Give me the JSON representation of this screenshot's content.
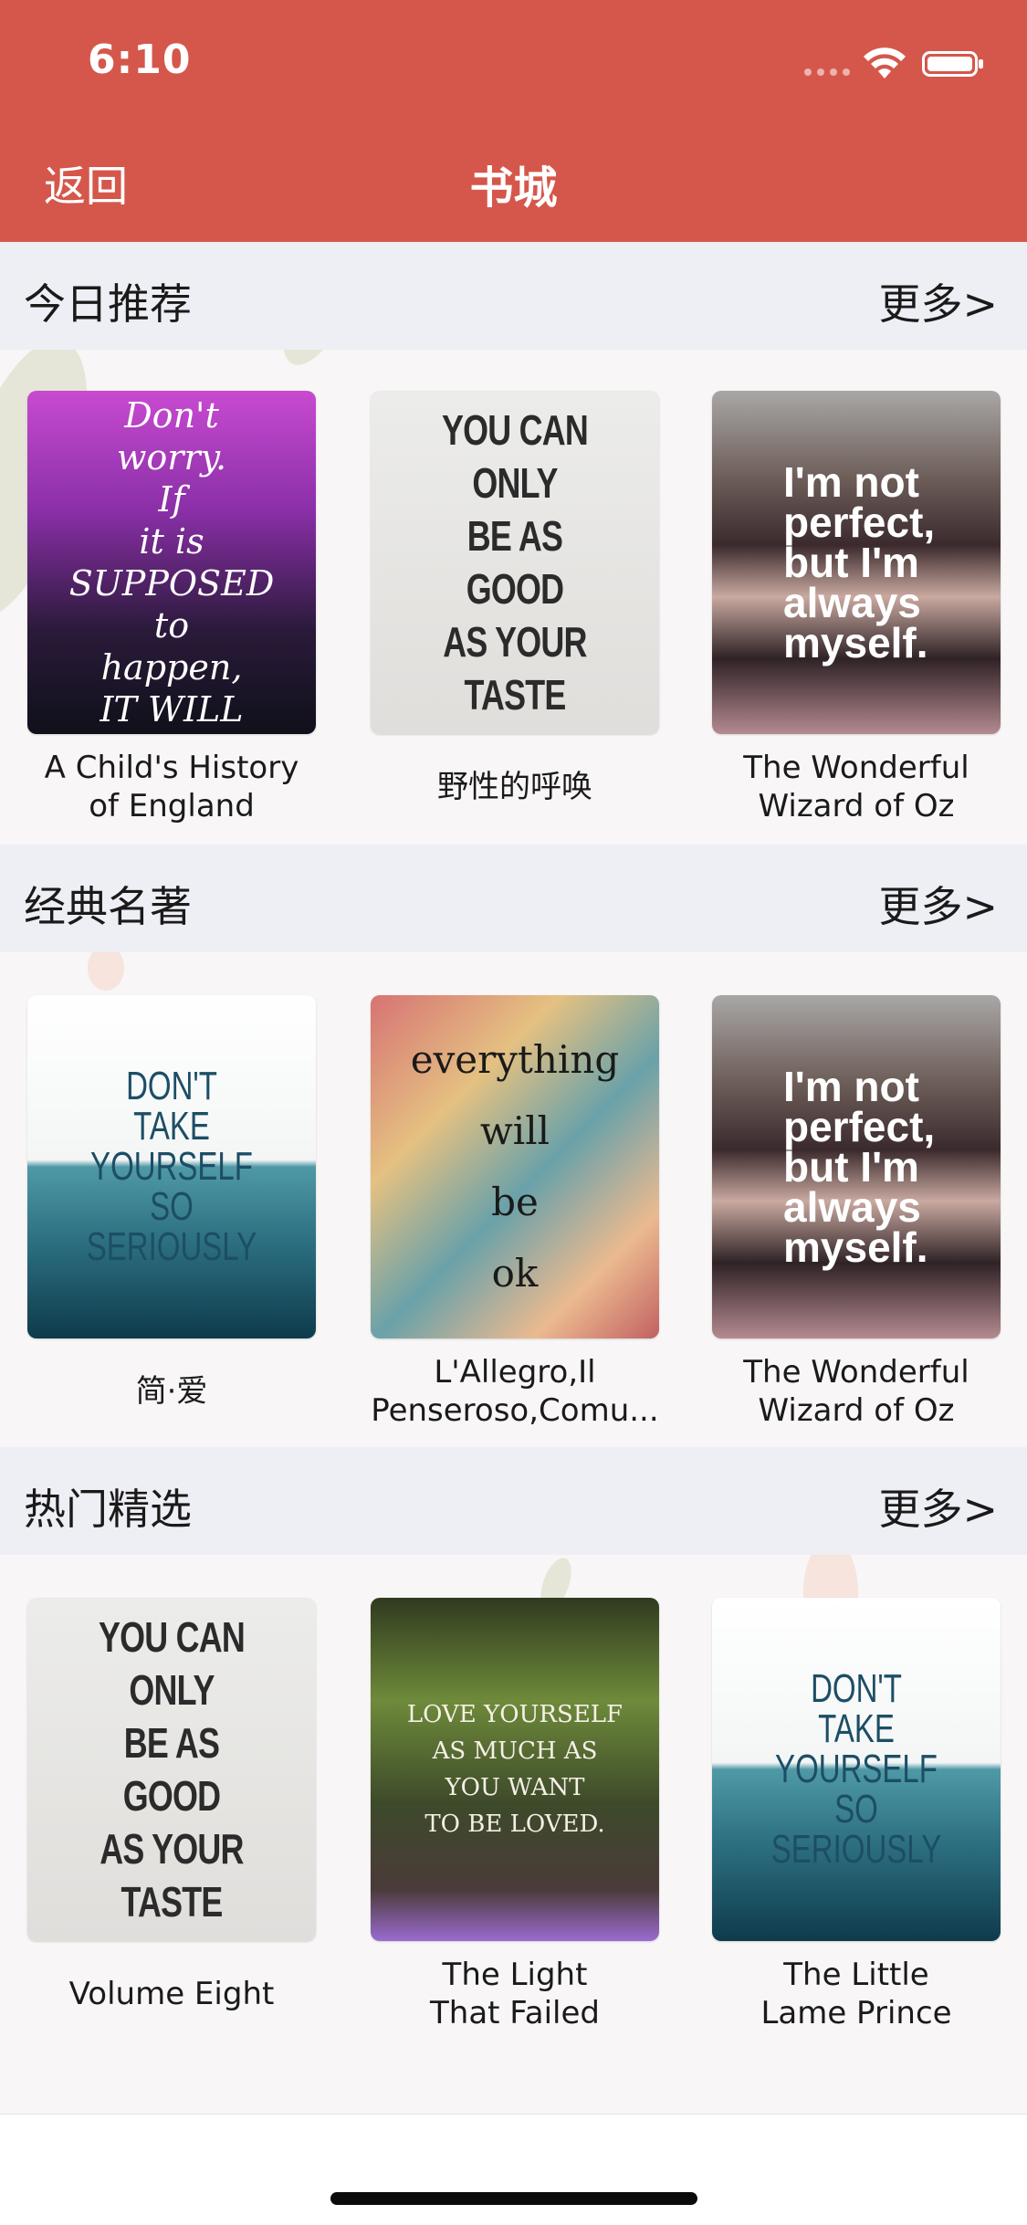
{
  "status_bar": {
    "time": "6:10"
  },
  "nav": {
    "back_label": "返回",
    "title": "书城"
  },
  "colors": {
    "header_red": "#d5574b",
    "section_bg": "#eeeff5"
  },
  "sections": [
    {
      "title": "今日推荐",
      "more_label": "更多>",
      "books": [
        {
          "title": "A Child's History\nof England",
          "cover_text": "Don't\nworry.\nIf\nit is\nSUPPOSED\nto\nhappen,\nIT WILL"
        },
        {
          "title": "野性的呼唤",
          "cover_text": "YOU CAN ONLY\nBE AS GOOD\nAS YOUR TASTE"
        },
        {
          "title": "The Wonderful\nWizard of Oz",
          "cover_text": "I'm not\nperfect,\nbut I'm\nalways\nmyself."
        }
      ]
    },
    {
      "title": "经典名著",
      "more_label": "更多>",
      "books": [
        {
          "title": "简·爱",
          "cover_text": "DON'T\nTAKE YOURSELF\nSO\nSERIOUSLY"
        },
        {
          "title": "L'Allegro,Il\nPenseroso,Comu...",
          "cover_text": "everything\nwill\nbe\nok"
        },
        {
          "title": "The Wonderful\nWizard of Oz",
          "cover_text": "I'm not\nperfect,\nbut I'm\nalways\nmyself."
        }
      ]
    },
    {
      "title": "热门精选",
      "more_label": "更多>",
      "books": [
        {
          "title": "Volume Eight",
          "cover_text": "YOU CAN ONLY\nBE AS GOOD\nAS YOUR TASTE"
        },
        {
          "title": "The Light\nThat Failed",
          "cover_text": "LOVE YOURSELF\nAS MUCH AS\nYOU WANT\nTO BE LOVED."
        },
        {
          "title": "The Little\nLame Prince",
          "cover_text": "DON'T\nTAKE YOURSELF\nSO\nSERIOUSLY"
        }
      ]
    }
  ]
}
